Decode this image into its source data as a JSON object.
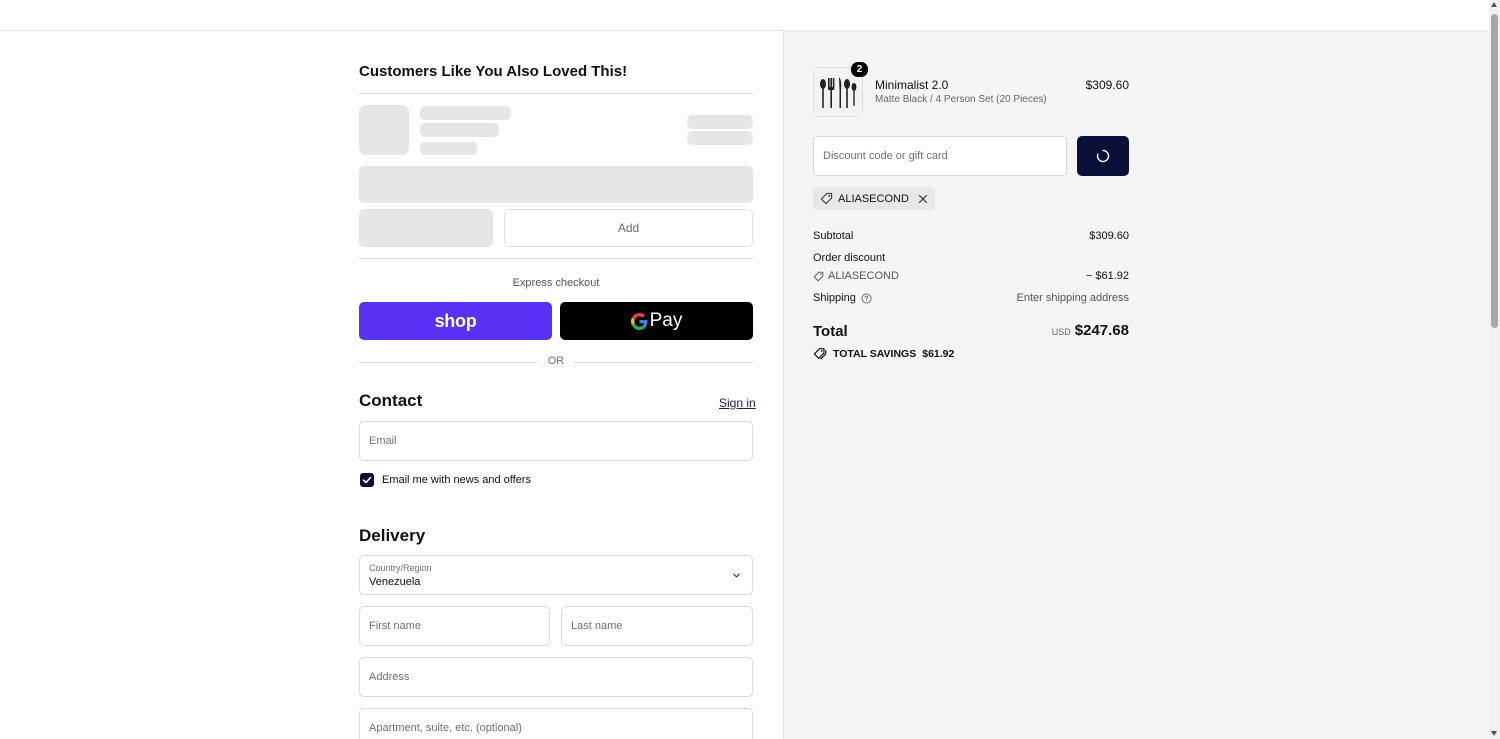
{
  "upsell": {
    "title": "Customers Like You Also Loved This!",
    "add_label": "Add"
  },
  "express": {
    "label": "Express checkout",
    "shop_label": "shop",
    "gpay_label": "Pay",
    "or_label": "OR"
  },
  "contact": {
    "heading": "Contact",
    "signin_label": "Sign in",
    "email_placeholder": "Email",
    "newsletter_label": "Email me with news and offers",
    "newsletter_checked": true
  },
  "delivery": {
    "heading": "Delivery",
    "country_label": "Country/Region",
    "country_value": "Venezuela",
    "first_name_placeholder": "First name",
    "last_name_placeholder": "Last name",
    "address_placeholder": "Address",
    "apartment_placeholder": "Apartment, suite, etc. (optional)"
  },
  "summary": {
    "item": {
      "name": "Minimalist 2.0",
      "variant": "Matte Black / 4 Person Set (20 Pieces)",
      "price": "$309.60",
      "quantity": "2"
    },
    "discount_placeholder": "Discount code or gift card",
    "applied_code": "ALIASECOND",
    "subtotal_label": "Subtotal",
    "subtotal_value": "$309.60",
    "order_discount_label": "Order discount",
    "discount_code": "ALIASECOND",
    "discount_value": "− $61.92",
    "shipping_label": "Shipping",
    "shipping_value": "Enter shipping address",
    "total_label": "Total",
    "currency": "USD",
    "total_value": "$247.68",
    "savings_label": "TOTAL SAVINGS",
    "savings_value": "$61.92"
  },
  "colors": {
    "shop_pay": "#5a31f4",
    "primary_dark": "#0a1038",
    "summary_bg": "#f5f5f5"
  }
}
